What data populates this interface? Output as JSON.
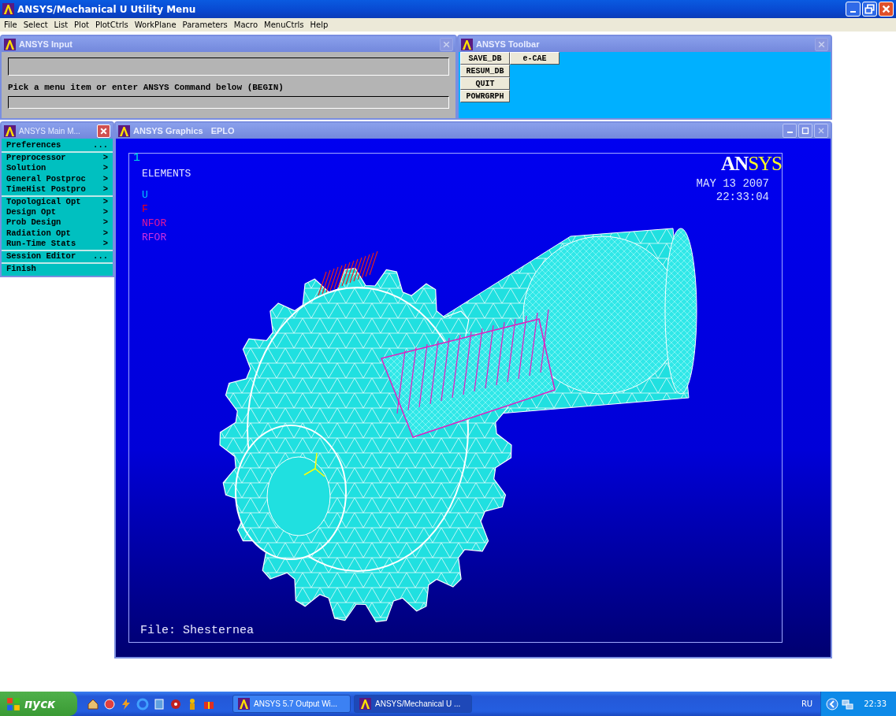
{
  "window": {
    "title": "ANSYS/Mechanical U Utility Menu"
  },
  "menu_bar": [
    "File",
    "Select",
    "List",
    "Plot",
    "PlotCtrls",
    "WorkPlane",
    "Parameters",
    "Macro",
    "MenuCtrls",
    "Help"
  ],
  "input_window": {
    "title": "ANSYS Input",
    "prompt": "Pick a menu item or enter ANSYS Command below (BEGIN)"
  },
  "toolbar_window": {
    "title": "ANSYS Toolbar",
    "button_rows": [
      [
        "SAVE_DB",
        "e-CAE"
      ],
      [
        "RESUM_DB"
      ],
      [
        "QUIT"
      ],
      [
        "POWRGRPH"
      ]
    ]
  },
  "main_menu": {
    "title": "ANSYS Main M...",
    "groups": [
      [
        {
          "label": "Preferences",
          "suffix": "..."
        }
      ],
      [
        {
          "label": "Preprocessor",
          "suffix": ">"
        },
        {
          "label": "Solution",
          "suffix": ">"
        },
        {
          "label": "General Postproc",
          "suffix": ">"
        },
        {
          "label": "TimeHist Postpro",
          "suffix": ">"
        }
      ],
      [
        {
          "label": "Topological Opt",
          "suffix": ">"
        },
        {
          "label": "Design Opt",
          "suffix": ">"
        },
        {
          "label": "Prob Design",
          "suffix": ">"
        },
        {
          "label": "Radiation Opt",
          "suffix": ">"
        },
        {
          "label": "Run-Time Stats",
          "suffix": ">"
        }
      ],
      [
        {
          "label": "Session Editor",
          "suffix": "..."
        }
      ],
      [
        {
          "label": "Finish"
        }
      ]
    ]
  },
  "graphics_window": {
    "title": "ANSYS Graphics",
    "subtitle": "EPLO",
    "window_number": "1",
    "heading": "ELEMENTS",
    "legend": [
      {
        "label": "U",
        "color": "#00c8ff"
      },
      {
        "label": "F",
        "color": "#ff0000"
      },
      {
        "label": "NFOR",
        "color": "#e0189a"
      },
      {
        "label": "RFOR",
        "color": "#d030e0"
      }
    ],
    "logo": [
      "AN",
      "SYS"
    ],
    "date": "MAY 13 2007",
    "time": "22:33:04",
    "file": "File: Shesternea"
  },
  "taskbar": {
    "start": "пуск",
    "tasks": [
      {
        "label": "ANSYS 5.7 Output Wi...",
        "selected": false
      },
      {
        "label": "ANSYS/Mechanical U ...",
        "selected": true
      }
    ],
    "language": "RU",
    "clock": "22:33"
  }
}
